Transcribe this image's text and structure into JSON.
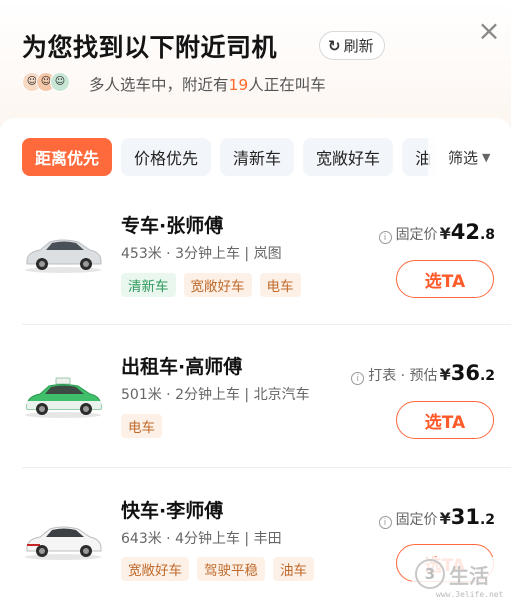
{
  "header": {
    "title": "为您找到以下附近司机",
    "refresh_label": "刷新",
    "status_prefix": "多人选车中，附近有",
    "status_count": "19",
    "status_suffix": "人正在叫车"
  },
  "tabs": [
    {
      "label": "距离优先",
      "active": true
    },
    {
      "label": "价格优先",
      "active": false
    },
    {
      "label": "清新车",
      "active": false
    },
    {
      "label": "宽敞好车",
      "active": false
    },
    {
      "label": "油",
      "active": false
    }
  ],
  "filter_label": "筛选",
  "drivers": [
    {
      "name": "专车·张师傅",
      "meta": "453米 · 3分钟上车 | 岚图",
      "tags": [
        {
          "label": "清新车",
          "style": "green"
        },
        {
          "label": "宽敞好车",
          "style": "orange"
        },
        {
          "label": "电车",
          "style": "orange"
        }
      ],
      "price_label": "固定价",
      "price_int": "42",
      "price_dec": ".8",
      "button_label": "选TA",
      "car_color": "#d9dcdf"
    },
    {
      "name": "出租车·高师傅",
      "meta": "501米 · 2分钟上车 | 北京汽车",
      "tags": [
        {
          "label": "电车",
          "style": "orange"
        }
      ],
      "price_label": "打表 · 预估",
      "price_int": "36",
      "price_dec": ".2",
      "button_label": "选TA",
      "car_color": "#3fbf6a"
    },
    {
      "name": "快车·李师傅",
      "meta": "643米 · 4分钟上车 | 丰田",
      "tags": [
        {
          "label": "宽敞好车",
          "style": "orange"
        },
        {
          "label": "驾驶平稳",
          "style": "orange"
        },
        {
          "label": "油车",
          "style": "orange"
        }
      ],
      "price_label": "固定价",
      "price_int": "31",
      "price_dec": ".2",
      "button_label": "选TA",
      "car_color": "#f2f2f2"
    }
  ],
  "price_currency": "¥",
  "watermark": {
    "logo": "3",
    "text": "生活",
    "url": "www.3elife.net"
  },
  "colors": {
    "accent": "#ff6a3d",
    "tag_green": "#2f9a5b",
    "tag_orange": "#c06a2c"
  }
}
